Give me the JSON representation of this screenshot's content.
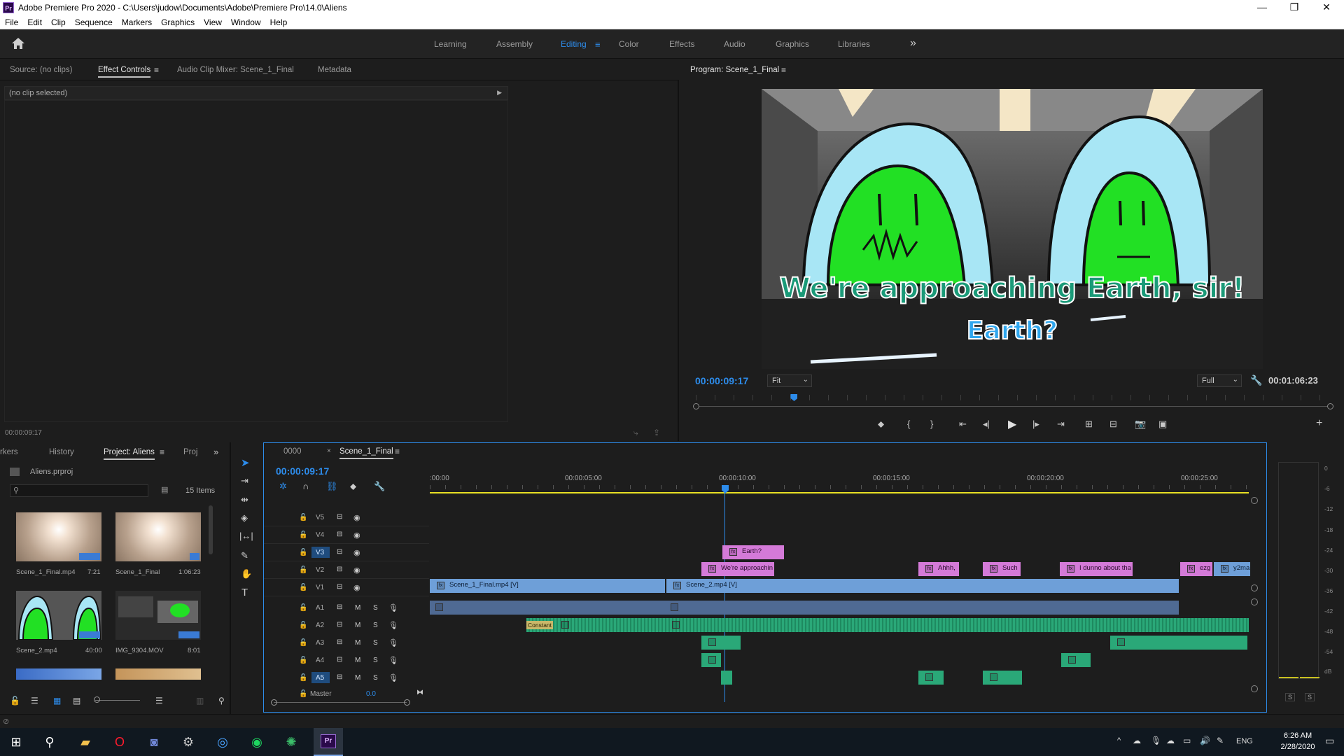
{
  "window": {
    "title": "Adobe Premiere Pro 2020 - C:\\Users\\judow\\Documents\\Adobe\\Premiere Pro\\14.0\\Aliens",
    "logo": "Pr",
    "minimize": "—",
    "restore": "❐",
    "close": "✕"
  },
  "menu": [
    "File",
    "Edit",
    "Clip",
    "Sequence",
    "Markers",
    "Graphics",
    "View",
    "Window",
    "Help"
  ],
  "workspaces": {
    "items": [
      "Learning",
      "Assembly",
      "Editing",
      "Color",
      "Effects",
      "Audio",
      "Graphics",
      "Libraries"
    ],
    "active": "Editing",
    "more": "»"
  },
  "source_panel": {
    "tabs": [
      "Source: (no clips)",
      "Effect Controls",
      "Audio Clip Mixer: Scene_1_Final",
      "Metadata"
    ],
    "active_tab": "Effect Controls",
    "no_clip": "(no clip selected)",
    "timecode": "00:00:09:17"
  },
  "program_monitor": {
    "title": "Program: Scene_1_Final",
    "timecode": "00:00:09:17",
    "duration": "00:01:06:23",
    "fit": "Fit",
    "quality": "Full",
    "playhead": 0.155,
    "caption_1": "We're approaching Earth, sir!",
    "caption_2": "Earth?"
  },
  "project_panel": {
    "tabs": [
      "rkers",
      "History",
      "Project: Aliens",
      "Proj"
    ],
    "active_tab": "Project: Aliens",
    "file": "Aliens.prproj",
    "count": "15 Items",
    "items": [
      {
        "name": "Scene_1_Final.mp4",
        "dur": "7:21"
      },
      {
        "name": "Scene_1_Final",
        "dur": "1:06:23"
      },
      {
        "name": "Scene_2.mp4",
        "dur": "40:00"
      },
      {
        "name": "IMG_9304.MOV",
        "dur": "8:01"
      }
    ]
  },
  "timeline": {
    "tabs": [
      "0000",
      "Scene_1_Final"
    ],
    "active_tab": "Scene_1_Final",
    "timecode": "00:00:09:17",
    "ruler": [
      ":00:00",
      "00:00:05:00",
      "00:00:10:00",
      "00:00:15:00",
      "00:00:20:00",
      "00:00:25:00"
    ],
    "video_tracks": [
      "V5",
      "V4",
      "V3",
      "V2",
      "V1"
    ],
    "audio_tracks": [
      "A1",
      "A2",
      "A3",
      "A4",
      "A5"
    ],
    "master": "Master",
    "master_val": "0.0",
    "clips": {
      "earth": "Earth?",
      "approach": "We're approachin",
      "ahhh": "Ahhh,",
      "such": "Such",
      "dunno": "I dunno about tha",
      "ezg": "ezg",
      "y2ma": "y2ma",
      "scene1": "Scene_1_Final.mp4 [V]",
      "scene2": "Scene_2.mp4 [V]",
      "constant": "Constant"
    }
  },
  "meter": {
    "labels": [
      "0",
      "-6",
      "-12",
      "-18",
      "-24",
      "-30",
      "-36",
      "-42",
      "-48",
      "-54",
      "dB"
    ],
    "solo": [
      "S",
      "S"
    ]
  },
  "taskbar": {
    "time": "6:26 AM",
    "date": "2/28/2020",
    "lang": "ENG"
  }
}
